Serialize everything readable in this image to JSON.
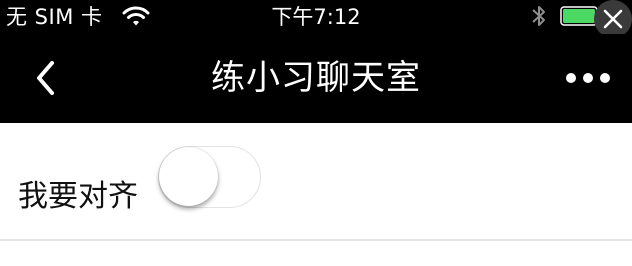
{
  "status_bar": {
    "carrier": "无 SIM 卡",
    "time": "下午7:12",
    "battery_color": "#4cd964",
    "icons": [
      "wifi-icon",
      "bluetooth-icon",
      "battery-icon",
      "close-icon"
    ]
  },
  "nav_bar": {
    "title": "练小习聊天室",
    "icons": [
      "chevron-left-icon",
      "more-horizontal-icon"
    ]
  },
  "form": {
    "align_label": "我要对齐",
    "align_toggle_on": false
  }
}
